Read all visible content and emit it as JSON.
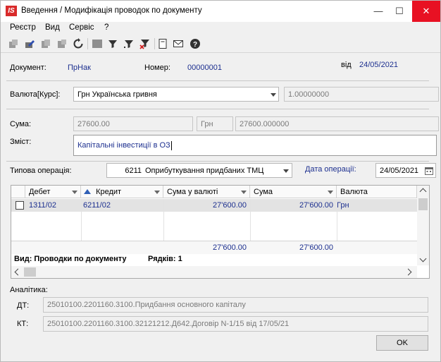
{
  "window": {
    "app_icon": "IS",
    "title": "Введення / Модифікація проводок по документу",
    "minimize_icon": "minimize-icon",
    "maximize_icon": "maximize-icon",
    "close_icon": "close-icon"
  },
  "menu": [
    "Реєстр",
    "Вид",
    "Сервіс",
    "?"
  ],
  "doc": {
    "label": "Документ:",
    "type": "ПрНак",
    "number_label": "Номер:",
    "number": "00000001",
    "date_label": "від",
    "date": "24/05/2021"
  },
  "currency": {
    "label": "Валюта[Курс]:",
    "value": "Грн Українська гривня",
    "rate": "1.00000000"
  },
  "sum": {
    "label": "Сума:",
    "value": "27600.00",
    "currency": "Грн",
    "value_cur": "27600.000000"
  },
  "content": {
    "label": "Зміст:",
    "value": "Капітальні інвестиції в ОЗ"
  },
  "operation": {
    "label": "Типова операція:",
    "code": "6211",
    "name": "Оприбуткування придбаних ТМЦ",
    "date_label": "Дата операції:",
    "date": "24/05/2021"
  },
  "grid": {
    "columns": [
      "Дебет",
      "Кредит",
      "Сума у валюті",
      "Сума",
      "Валюта"
    ],
    "rows": [
      {
        "debit": "1311/02",
        "credit": "6211/02",
        "sum_cur": "27'600.00",
        "sum": "27'600.00",
        "currency": "Грн"
      }
    ],
    "totals": {
      "sum_cur": "27'600.00",
      "sum": "27'600.00"
    },
    "view_label": "Вид: Проводки по документу",
    "rows_label": "Рядків: 1"
  },
  "analytics": {
    "label": "Аналітика:",
    "dt_label": "ДТ:",
    "dt": "25010100.2201160.3100.Придбання основного капіталу",
    "kt_label": "КТ:",
    "kt": "25010100.2201160.3100.32121212.Д642.Договір N-1/15 від 17/05/21"
  },
  "ok_label": "OK"
}
